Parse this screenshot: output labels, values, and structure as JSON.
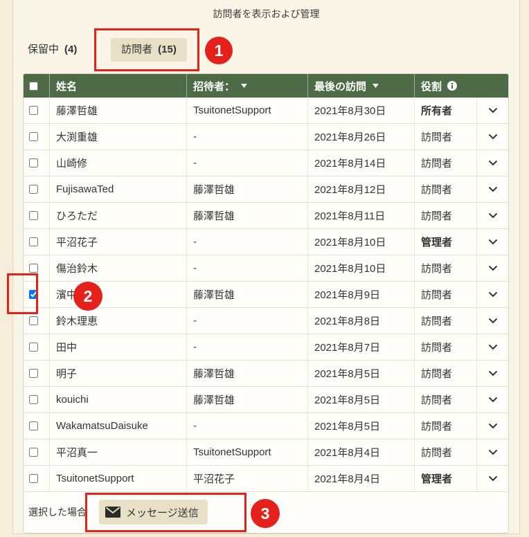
{
  "page": {
    "title": "訪問者を表示および管理"
  },
  "tabs": [
    {
      "label": "保留中",
      "count": "(4)",
      "active": false
    },
    {
      "label": "訪問者",
      "count": "(15)",
      "active": true
    }
  ],
  "table": {
    "columns": {
      "name": "姓名",
      "inviter": "招待者：",
      "last_visit": "最後の訪問",
      "role": "役割"
    },
    "select_all_checked": false,
    "rows": [
      {
        "name": "藤澤哲雄",
        "inviter": "TsuitonetSupport",
        "last_visit": "2021年8月30日",
        "role": "所有者",
        "emphasis": true,
        "checked": false
      },
      {
        "name": "大渕重雄",
        "inviter": "-",
        "last_visit": "2021年8月26日",
        "role": "訪問者",
        "emphasis": false,
        "checked": false
      },
      {
        "name": "山崎修",
        "inviter": "-",
        "last_visit": "2021年8月14日",
        "role": "訪問者",
        "emphasis": false,
        "checked": false
      },
      {
        "name": "FujisawaTed",
        "inviter": "藤澤哲雄",
        "last_visit": "2021年8月12日",
        "role": "訪問者",
        "emphasis": false,
        "checked": false
      },
      {
        "name": "ひろただ",
        "inviter": "藤澤哲雄",
        "last_visit": "2021年8月11日",
        "role": "訪問者",
        "emphasis": false,
        "checked": false
      },
      {
        "name": "平沼花子",
        "inviter": "-",
        "last_visit": "2021年8月10日",
        "role": "管理者",
        "emphasis": true,
        "checked": false
      },
      {
        "name": "傷治鈴木",
        "inviter": "-",
        "last_visit": "2021年8月10日",
        "role": "訪問者",
        "emphasis": false,
        "checked": false
      },
      {
        "name": "濱中",
        "inviter": "藤澤哲雄",
        "last_visit": "2021年8月9日",
        "role": "訪問者",
        "emphasis": false,
        "checked": true
      },
      {
        "name": "鈴木理恵",
        "inviter": "-",
        "last_visit": "2021年8月8日",
        "role": "訪問者",
        "emphasis": false,
        "checked": false
      },
      {
        "name": "田中",
        "inviter": "-",
        "last_visit": "2021年8月7日",
        "role": "訪問者",
        "emphasis": false,
        "checked": false
      },
      {
        "name": "明子",
        "inviter": "藤澤哲雄",
        "last_visit": "2021年8月5日",
        "role": "訪問者",
        "emphasis": false,
        "checked": false
      },
      {
        "name": "kouichi",
        "inviter": "藤澤哲雄",
        "last_visit": "2021年8月5日",
        "role": "訪問者",
        "emphasis": false,
        "checked": false
      },
      {
        "name": "WakamatsuDaisuke",
        "inviter": "-",
        "last_visit": "2021年8月5日",
        "role": "訪問者",
        "emphasis": false,
        "checked": false
      },
      {
        "name": "平沼真一",
        "inviter": "TsuitonetSupport",
        "last_visit": "2021年8月4日",
        "role": "訪問者",
        "emphasis": false,
        "checked": false
      },
      {
        "name": "TsuitonetSupport",
        "inviter": "平沼花子",
        "last_visit": "2021年8月4日",
        "role": "管理者",
        "emphasis": true,
        "checked": false
      }
    ]
  },
  "footer": {
    "selection_label": "選択した場合",
    "send_message_label": "メッセージ送信"
  },
  "annotations": [
    {
      "number": "1"
    },
    {
      "number": "2"
    },
    {
      "number": "3"
    }
  ],
  "icons": {
    "sort": "caret-down-icon",
    "info": "info-icon",
    "expand": "chevron-down-icon",
    "message": "envelope-icon"
  },
  "colors": {
    "header_bg": "#4e6b47",
    "annotation_red": "#e4221b",
    "button_bg": "#e8dfc7",
    "page_bg": "#f6eedb",
    "card_bg": "#faf5e7",
    "row_bg": "#fefdf9"
  }
}
